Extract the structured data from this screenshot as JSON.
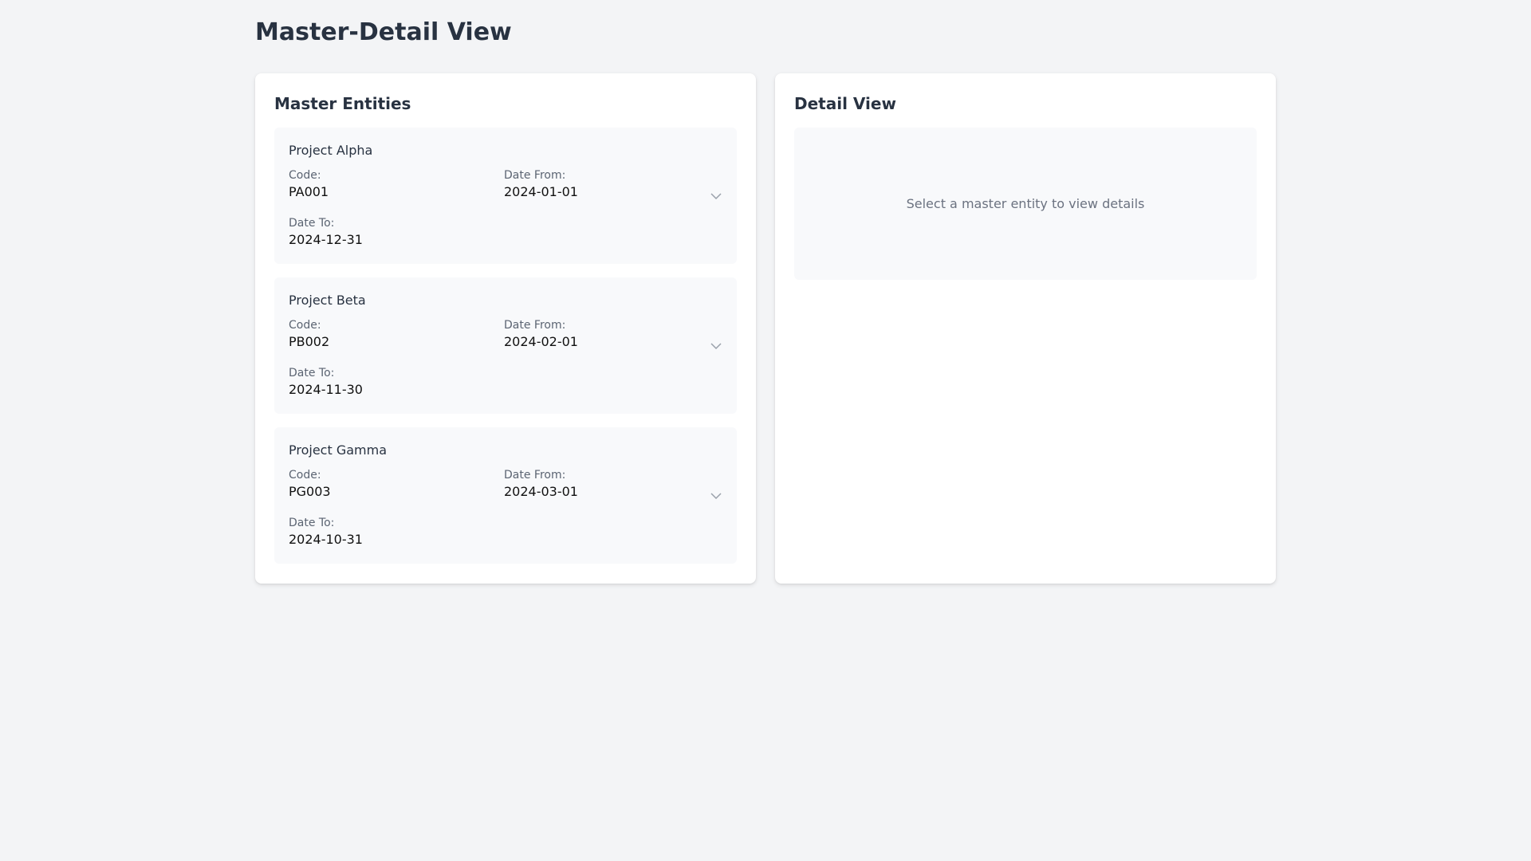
{
  "page": {
    "title": "Master-Detail View"
  },
  "master": {
    "title": "Master Entities",
    "labels": {
      "code": "Code:",
      "date_from": "Date From:",
      "date_to": "Date To:"
    },
    "entities": [
      {
        "name": "Project Alpha",
        "code": "PA001",
        "date_from": "2024-01-01",
        "date_to": "2024-12-31"
      },
      {
        "name": "Project Beta",
        "code": "PB002",
        "date_from": "2024-02-01",
        "date_to": "2024-11-30"
      },
      {
        "name": "Project Gamma",
        "code": "PG003",
        "date_from": "2024-03-01",
        "date_to": "2024-10-31"
      }
    ],
    "expand_icon": "chevron-down-icon"
  },
  "detail": {
    "title": "Detail View",
    "empty_message": "Select a master entity to view details"
  },
  "colors": {
    "background": "#f3f4f6",
    "panel": "#ffffff",
    "card": "#f8f9fb",
    "heading": "#283241",
    "muted": "#6b7280"
  }
}
